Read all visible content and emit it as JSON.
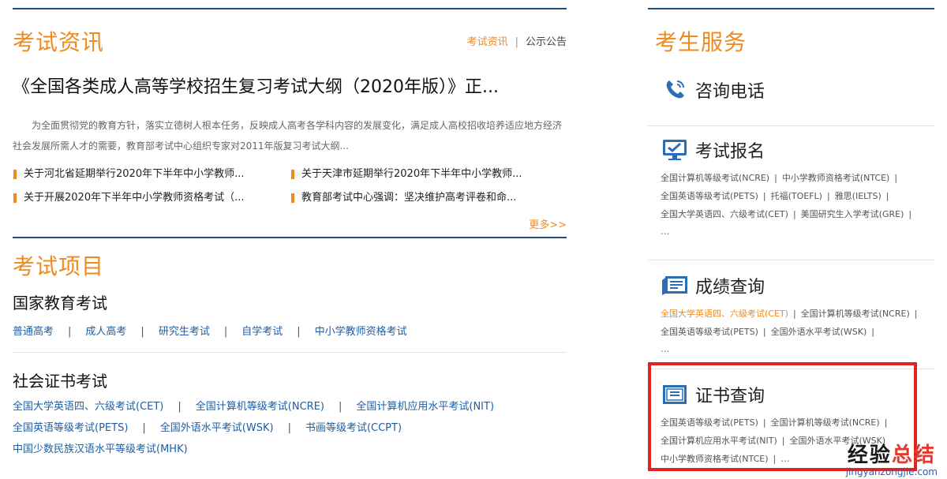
{
  "exam_news": {
    "title": "考试资讯",
    "tab_active": "考试资讯",
    "tab_separator": "|",
    "tab_other": "公示公告",
    "headline": "《全国各类成人高等学校招生复习考试大纲（2020年版）》正...",
    "summary": "为全面贯彻党的教育方针，落实立德树人根本任务，反映成人高考各学科内容的发展变化，满足成人高校招收培养适应地方经济社会发展所需人才的需要，教育部考试中心组织专家对2011年版复习考试大纲...",
    "news": [
      "关于河北省延期举行2020年下半年中小学教师...",
      "关于天津市延期举行2020年下半年中小学教师...",
      "关于开展2020年下半年中小学教师资格考试（...",
      "教育部考试中心强调：坚决维护高考评卷和命..."
    ],
    "more": "更多>>"
  },
  "exam_projects": {
    "title": "考试项目",
    "national": {
      "title": "国家教育考试",
      "links": [
        "普通高考",
        "成人高考",
        "研究生考试",
        "自学考试",
        "中小学教师资格考试"
      ]
    },
    "cert": {
      "title": "社会证书考试",
      "rows": [
        [
          "全国大学英语四、六级考试(CET)",
          "全国计算机等级考试(NCRE)",
          "全国计算机应用水平考试(NIT)"
        ],
        [
          "全国英语等级考试(PETS)",
          "全国外语水平考试(WSK)",
          "书画等级考试(CCPT)"
        ],
        [
          "中国少数民族汉语水平等级考试(MHK)"
        ]
      ]
    },
    "separator": "|"
  },
  "services": {
    "title": "考生服务",
    "separator": "|",
    "consult": {
      "title": "咨询电话",
      "icon": "phone-icon"
    },
    "registration": {
      "title": "考试报名",
      "icon": "monitor-check-icon",
      "lines": [
        [
          "全国计算机等级考试(NCRE)",
          "中小学教师资格考试(NTCE)"
        ],
        [
          "全国英语等级考试(PETS)",
          "托福(TOEFL)",
          "雅思(IELTS)"
        ],
        [
          "全国大学英语四、六级考试(CET)",
          "美国研究生入学考试(GRE)"
        ]
      ],
      "more": "..."
    },
    "scores": {
      "title": "成绩查询",
      "icon": "report-icon",
      "lines": [
        [
          "全国大学英语四、六级考试(CET)",
          "全国计算机等级考试(NCRE)"
        ],
        [
          "全国英语等级考试(PETS)",
          "全国外语水平考试(WSK)"
        ]
      ],
      "more": "..."
    },
    "certificate": {
      "title": "证书查询",
      "icon": "certificate-icon",
      "lines": [
        [
          "全国英语等级考试(PETS)",
          "全国计算机等级考试(NCRE)"
        ],
        [
          "全国计算机应用水平考试(NIT)",
          "全国外语水平考试(WSK)"
        ],
        [
          "中小学教师资格考试(NTCE)"
        ]
      ],
      "more": "..."
    }
  },
  "watermark": {
    "zh_1": "经验",
    "zh_2": "总结",
    "en": "jingyanzongjie.com"
  },
  "colors": {
    "accent_orange": "#ef8a1e",
    "link_blue": "#1e5ea3",
    "rule_navy": "#1e4f82",
    "highlight_red": "#e1231f"
  }
}
